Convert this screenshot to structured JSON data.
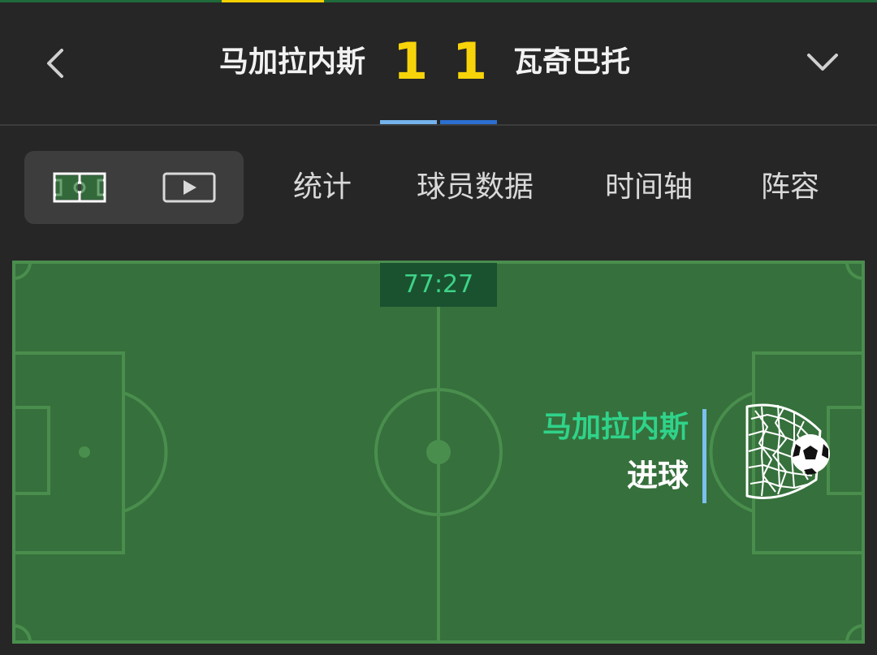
{
  "header": {
    "home_team": "马加拉内斯",
    "away_team": "瓦奇巴托",
    "home_score": "1",
    "away_score": "1",
    "back_icon": "chevron-left-icon",
    "collapse_icon": "chevron-down-icon"
  },
  "view_toggle": {
    "pitch_icon": "pitch-icon",
    "video_icon": "play-video-icon",
    "selected": "pitch"
  },
  "tabs": [
    {
      "label": "统计"
    },
    {
      "label": "球员数据"
    },
    {
      "label": "时间轴"
    },
    {
      "label": "阵容"
    }
  ],
  "pitch": {
    "clock": "77:27",
    "event": {
      "team": "马加拉内斯",
      "type": "进球",
      "icon": "goal-net-ball-icon"
    }
  },
  "colors": {
    "background": "#262626",
    "score": "#f7d40a",
    "pitch": "#36703c",
    "clock_text": "#3ed388",
    "event_team": "#2fd38a",
    "home_bar": "#74b3ec",
    "away_bar": "#2b6fd0"
  }
}
